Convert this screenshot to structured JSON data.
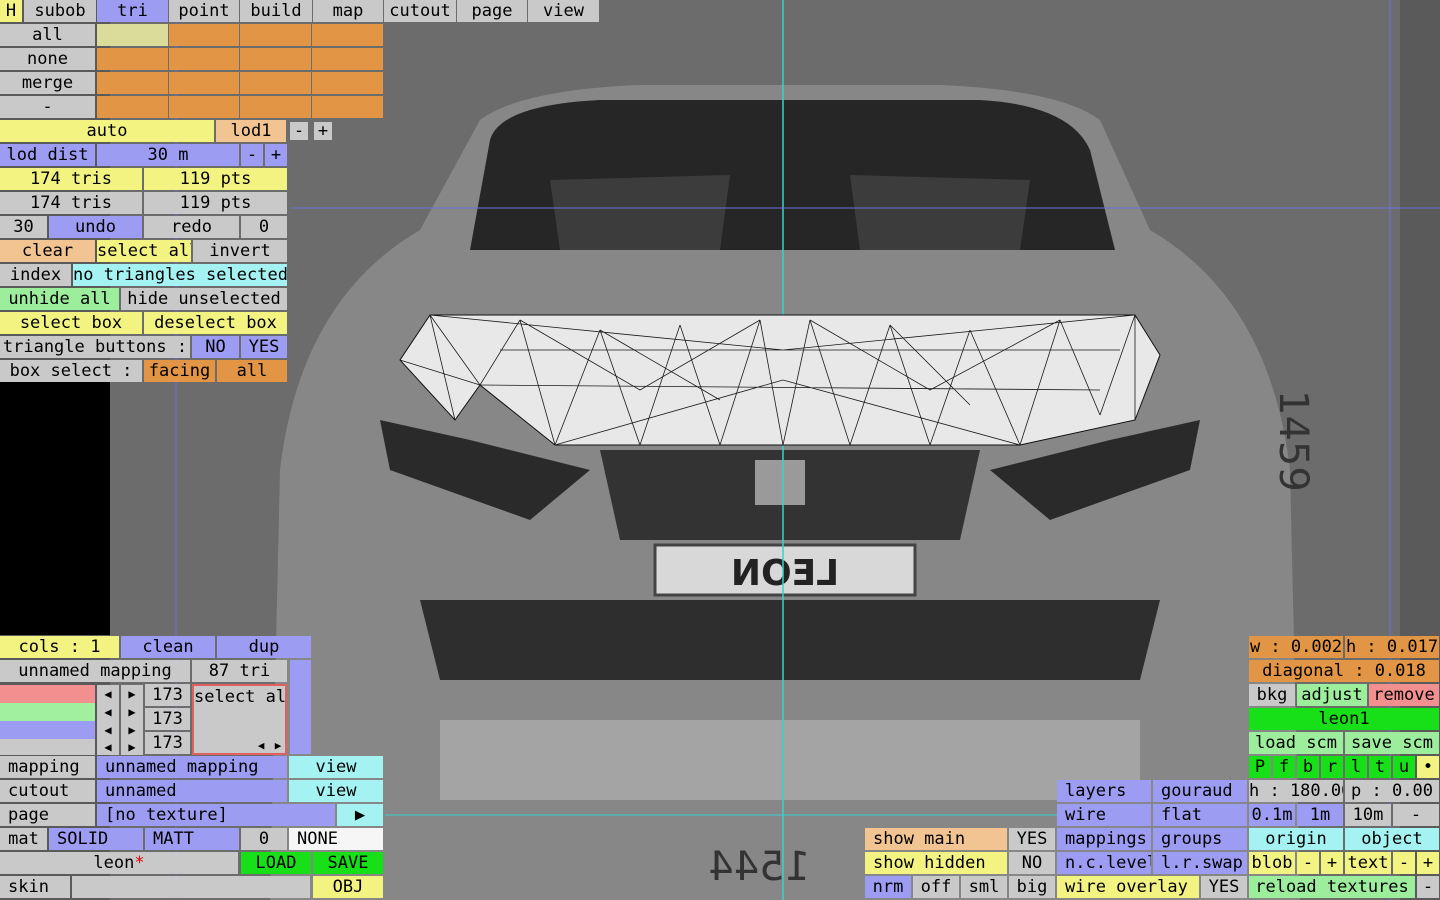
{
  "menu": {
    "h": "H",
    "tabs": [
      "subob",
      "tri",
      "point",
      "build",
      "map",
      "cutout",
      "page",
      "view"
    ]
  },
  "sel": {
    "all": "all",
    "none": "none",
    "merge": "merge",
    "dash": "-"
  },
  "lod": {
    "auto": "auto",
    "name": "lod1",
    "minus": "-",
    "plus": "+",
    "dist_label": "lod dist",
    "dist_value": "30 m",
    "dist_minus": "-",
    "dist_plus": "+"
  },
  "stats": {
    "tris1": "174 tris",
    "pts1": "119 pts",
    "tris2": "174 tris",
    "pts2": "119 pts"
  },
  "hist": {
    "count": "30",
    "undo": "undo",
    "redo": "redo",
    "redo_count": "0"
  },
  "ops": {
    "clear": "clear",
    "select_all": "select all",
    "invert": "invert",
    "index": "index",
    "status": "no triangles selected",
    "unhide_all": "unhide all",
    "hide_unselected": "hide unselected",
    "select_box": "select box",
    "deselect_box": "deselect box",
    "tri_buttons": "triangle buttons :",
    "no": "NO",
    "yes": "YES",
    "box_select": "box select :",
    "facing": "facing",
    "box_all": "all"
  },
  "cols": {
    "label": "cols : 1",
    "clean": "clean",
    "dup": "dup",
    "mapping_name": "unnamed mapping",
    "tri_count": "87 tri",
    "rows": [
      "173",
      "173",
      "173"
    ],
    "select_all": "select all",
    "left": "◀",
    "right": "▶"
  },
  "mappingrows": {
    "mapping": "mapping",
    "mapping_value": "unnamed mapping",
    "view": "view",
    "cutout": "cutout",
    "cutout_value": "unnamed",
    "cutout_view": "view",
    "page": "page",
    "texture": "[no texture]",
    "play": "▶",
    "mat": "mat",
    "solid": "SOLID",
    "matt": "MATT",
    "num": "0",
    "none": "NONE",
    "file": "leon",
    "star": "*",
    "load": "LOAD",
    "save": "SAVE",
    "skin": "skin",
    "obj": "OBJ"
  },
  "showpanel": {
    "show_main": "show main",
    "main_yes": "YES",
    "show_hidden": "show hidden",
    "hidden_no": "NO",
    "nrm": "nrm",
    "off": "off",
    "sml": "sml",
    "big": "big"
  },
  "render": {
    "layers": "layers",
    "gouraud": "gouraud",
    "wire": "wire",
    "flat": "flat",
    "mappings": "mappings",
    "groups": "groups",
    "nclevel": "n.c.level",
    "lrswap": "l.r.swap",
    "wire_overlay": "wire overlay",
    "overlay_yes": "YES"
  },
  "bkg": {
    "w": "w : 0.002",
    "h": "h : 0.017",
    "diag": "diagonal : 0.018",
    "bkg": "bkg",
    "adjust": "adjust",
    "remove": "remove",
    "name": "leon1",
    "load_scm": "load scm",
    "save_scm": "save scm",
    "views": [
      "P",
      "f",
      "b",
      "r",
      "l",
      "t",
      "u",
      "•"
    ],
    "hval": "h : 180.00",
    "pval": "p : 0.00",
    "s01": "0.1m",
    "s1": "1m",
    "s10": "10m",
    "sminus": "-",
    "origin": "origin",
    "object": "object",
    "blob": "blob",
    "bminus": "-",
    "bplus": "+",
    "text": "text",
    "tminus": "-",
    "tplus": "+",
    "reload": "reload textures",
    "rminus": "-"
  },
  "viewport": {
    "plate": "LEON",
    "dim_right": "1459",
    "dim_bottom": "1544"
  },
  "colors": {
    "accent": "#9c9cf2",
    "gray": "#c9c9c9",
    "yellow": "#f3f382",
    "orange": "#e29544",
    "cyan": "#a4f2f2",
    "green": "#18e018"
  }
}
